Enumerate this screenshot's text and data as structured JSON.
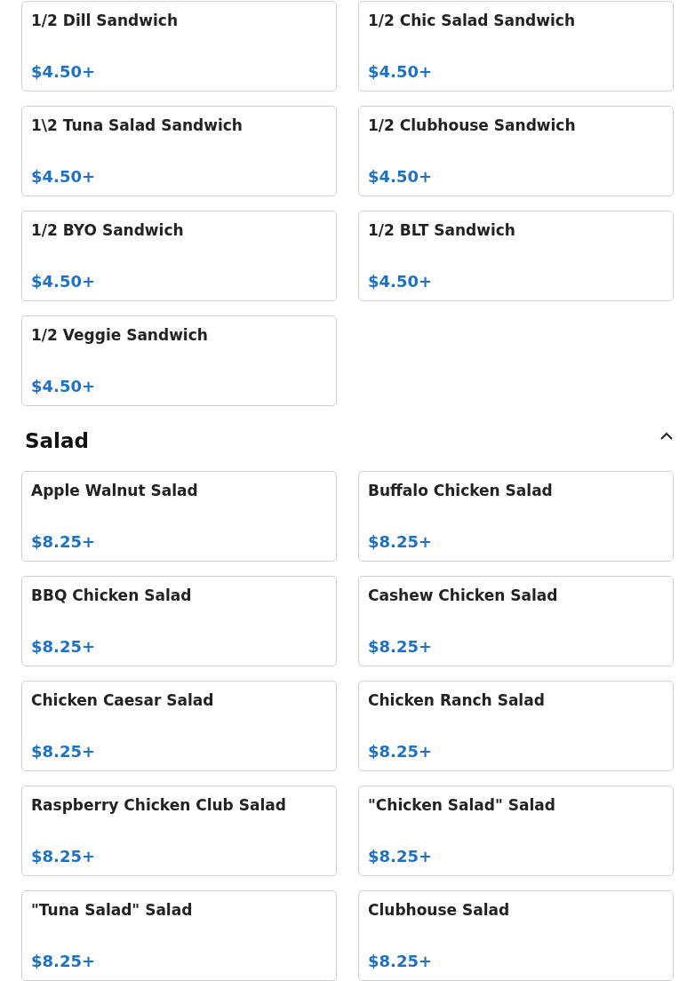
{
  "sections": [
    {
      "items": [
        {
          "name": "1/2 Dill Sandwich",
          "price": "$4.50+"
        },
        {
          "name": "1/2 Chic Salad Sandwich",
          "price": "$4.50+"
        },
        {
          "name": "1\\2 Tuna Salad Sandwich",
          "price": "$4.50+"
        },
        {
          "name": "1/2 Clubhouse Sandwich",
          "price": "$4.50+"
        },
        {
          "name": "1/2 BYO Sandwich",
          "price": "$4.50+"
        },
        {
          "name": "1/2 BLT Sandwich",
          "price": "$4.50+"
        },
        {
          "name": "1/2 Veggie Sandwich",
          "price": "$4.50+"
        }
      ]
    },
    {
      "title": "Salad",
      "expanded": true,
      "items": [
        {
          "name": "Apple Walnut Salad",
          "price": "$8.25+"
        },
        {
          "name": "Buffalo Chicken Salad",
          "price": "$8.25+"
        },
        {
          "name": "BBQ Chicken Salad",
          "price": "$8.25+"
        },
        {
          "name": "Cashew Chicken Salad",
          "price": "$8.25+"
        },
        {
          "name": "Chicken Caesar Salad",
          "price": "$8.25+"
        },
        {
          "name": "Chicken Ranch Salad",
          "price": "$8.25+"
        },
        {
          "name": "Raspberry Chicken Club Salad",
          "price": "$8.25+"
        },
        {
          "name": "\"Chicken Salad\" Salad",
          "price": "$8.25+"
        },
        {
          "name": "\"Tuna Salad\" Salad",
          "price": "$8.25+"
        },
        {
          "name": "Clubhouse Salad",
          "price": "$8.25+"
        }
      ]
    }
  ]
}
